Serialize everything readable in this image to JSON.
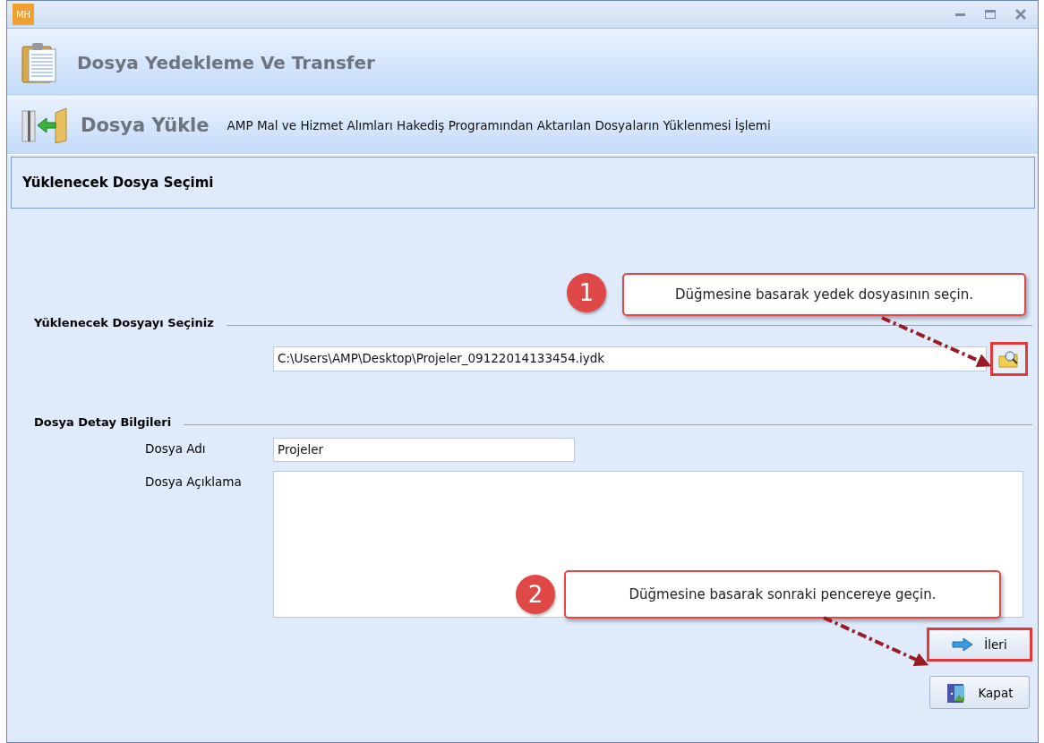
{
  "window": {
    "app_badge": "MH"
  },
  "header": {
    "title": "Dosya Yedekleme Ve Transfer"
  },
  "subheader": {
    "title": "Dosya Yükle",
    "description": "AMP Mal ve Hizmet Alımları Hakediş Programından Aktarılan Dosyaların Yüklenmesi İşlemi"
  },
  "section": {
    "title": "Yüklenecek Dosya Seçimi"
  },
  "file_group": {
    "title": "Yüklenecek Dosyayı Seçiniz",
    "path": "C:\\Users\\AMP\\Desktop\\Projeler_09122014133454.iydk",
    "browse_highlighted": true
  },
  "details_group": {
    "title": "Dosya Detay Bilgileri",
    "fields": [
      {
        "label": "Dosya Adı",
        "value": "Projeler",
        "kind": "line"
      },
      {
        "label": "Dosya Açıklama",
        "kind": "area"
      }
    ]
  },
  "buttons": [
    {
      "label": "İleri",
      "kind": "next",
      "highlighted": true
    },
    {
      "label": "Kapat",
      "kind": "close",
      "highlighted": false
    }
  ],
  "annotations": [
    {
      "number": "1",
      "text": "Düğmesine basarak yedek dosyasının seçin."
    },
    {
      "number": "2",
      "text": "Düğmesine basarak sonraki pencereye geçin."
    }
  ]
}
